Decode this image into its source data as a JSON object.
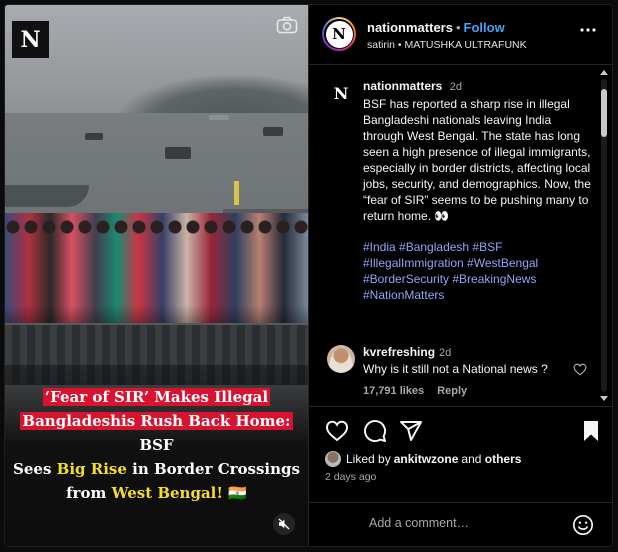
{
  "media": {
    "logo_letter": "N",
    "overlay": {
      "line1": "‘Fear of SIR’ Makes Illegal",
      "line2_highlight": "Bangladeshis Rush Back Home:",
      "line2_rest": "BSF",
      "line3_a": "Sees",
      "line3_highlight": "Big Rise",
      "line3_b": "in Border Crossings",
      "line4_a": "from",
      "line4_highlight": "West Bengal!",
      "line4_flag": "🇮🇳"
    }
  },
  "header": {
    "username": "nationmatters",
    "separator": "•",
    "follow_label": "Follow",
    "subtitle": "satirin • MATUSHKA ULTRAFUNK",
    "avatar_letter": "N"
  },
  "caption": {
    "avatar_letter": "N",
    "username": "nationmatters",
    "time": "2d",
    "text": "BSF has reported a sharp rise in illegal Bangladeshi nationals leaving India through West Bengal. The state has long seen a high presence of illegal immigrants, especially in border districts, affecting local jobs, security, and demographics. Now, the “fear of SIR” seems to be pushing many to return home. 👀",
    "hashtags": [
      "#India #Bangladesh #BSF",
      "#IllegalImmigration #WestBengal",
      "#BorderSecurity #BreakingNews",
      "#NationMatters"
    ]
  },
  "comment": {
    "username": "kvrefreshing",
    "time": "2d",
    "text": "Why is it still not a National news ?",
    "likes": "17,791 likes",
    "reply_label": "Reply"
  },
  "actions": {
    "icons": [
      "heart-icon",
      "comment-icon",
      "share-icon",
      "bookmark-icon"
    ],
    "liked_by_prefix": "Liked by",
    "liked_by_user": "ankitwzone",
    "liked_by_and": "and",
    "liked_by_others": "others",
    "date": "2 days ago"
  },
  "add_comment": {
    "placeholder": "Add a comment…"
  },
  "colors": {
    "follow": "#4a9ef5",
    "hashtag": "#8fa4f8",
    "highlight_red": "#d7132f",
    "highlight_yellow": "#f5dd2d"
  }
}
